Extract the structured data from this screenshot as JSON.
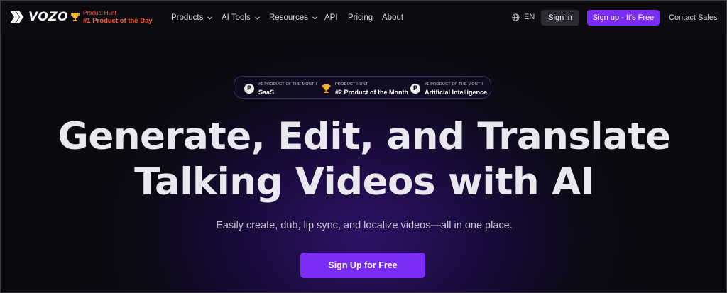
{
  "nav": {
    "logo_text": "VOZO",
    "product_hunt": {
      "line1": "Product Hunt",
      "line2": "#1 Product of the Day"
    },
    "menu": [
      {
        "label": "Products",
        "has_dropdown": true
      },
      {
        "label": "AI Tools",
        "has_dropdown": true
      },
      {
        "label": "Resources",
        "has_dropdown": true
      },
      {
        "label": "API",
        "has_dropdown": false
      },
      {
        "label": "Pricing",
        "has_dropdown": false
      },
      {
        "label": "About",
        "has_dropdown": false
      }
    ],
    "language": "EN",
    "sign_in": "Sign in",
    "sign_up": "Sign up - It's Free",
    "contact": "Contact Sales"
  },
  "awards": [
    {
      "icon": "product-hunt-badge-icon",
      "small": "#1 PRODUCT OF THE MONTH",
      "big": "SaaS"
    },
    {
      "icon": "trophy-icon",
      "small": "PRODUCT HUNT",
      "big": "#2 Product of the Month"
    },
    {
      "icon": "product-hunt-badge-icon",
      "small": "#1 PRODUCT OF THE MONTH",
      "big": "Artificial Intelligence"
    }
  ],
  "hero": {
    "title_line1": "Generate, Edit, and Translate",
    "title_line2": "Talking Videos with AI",
    "subtitle": "Easily create, dub, lip sync, and localize videos—all in one place.",
    "cta": "Sign Up for Free"
  },
  "colors": {
    "accent": "#7a2bf5",
    "product_hunt": "#ff5a3c",
    "background": "#0a0a0f"
  }
}
